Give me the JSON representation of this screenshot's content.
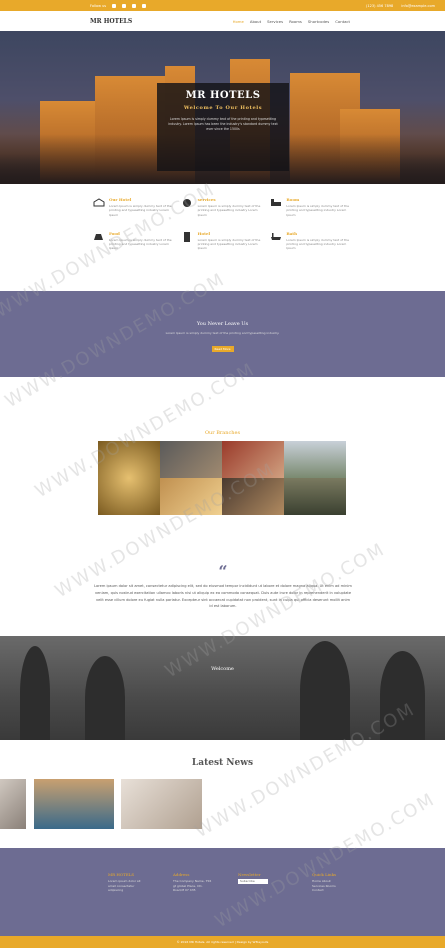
{
  "topbar": {
    "follow_label": "Follow us",
    "social_icons": [
      "facebook-icon",
      "twitter-icon",
      "linkedin-icon",
      "pinterest-icon"
    ],
    "phone": "(123) 456 7898",
    "email": "info@example.com"
  },
  "navbar": {
    "logo": "MR HOTELS",
    "menu": [
      "Home",
      "About",
      "Services",
      "Rooms",
      "Shortcodes",
      "Contact"
    ]
  },
  "hero": {
    "title": "MR HOTELS",
    "subtitle": "Welcome To Our Hotels",
    "text": "Lorem Ipsum is simply dummy text of the printing and typesetting industry. Lorem Ipsum has been the industry's standard dummy text ever since the 1500s"
  },
  "features": [
    {
      "icon": "hotel-icon",
      "title": "Our Hotel",
      "text": "Lorem Ipsum is simply dummy text of the printing and typesetting industry Lorem Ipsum"
    },
    {
      "icon": "services-icon",
      "title": "services",
      "text": "Lorem Ipsum is simply dummy text of the printing and typesetting industry Lorem Ipsum"
    },
    {
      "icon": "room-icon",
      "title": "Room",
      "text": "Lorem Ipsum is simply dummy text of the printing and typesetting industry Lorem Ipsum"
    },
    {
      "icon": "food-icon",
      "title": "Food",
      "text": "Lorem Ipsum is simply dummy text of the printing and typesetting industry Lorem Ipsum"
    },
    {
      "icon": "hotel-building-icon",
      "title": "Hotel",
      "text": "Lorem Ipsum is simply dummy text of the printing and typesetting industry Lorem Ipsum"
    },
    {
      "icon": "bath-icon",
      "title": "Bath",
      "text": "Lorem Ipsum is simply dummy text of the printing and typesetting industry Lorem Ipsum"
    }
  ],
  "band": {
    "title": "You Never Leave Us",
    "text": "Lorem Ipsum is simply dummy text of the printing and typesetting industry.",
    "button": "Read More"
  },
  "branches": {
    "title": "Our Branches"
  },
  "quote": {
    "mark": "“",
    "text": "Lorem ipsum dolor sit amet, consectetur adipiscing elit, sed do eiusmod tempor incididunt ut labore et dolore magna aliqua. Ut enim ad minim veniam, quis nostrud exercitation ullamco laboris nisi ut aliquip ex ea commodo consequat. Duis aute irure dolor in reprehenderit in voluptate velit esse cillum dolore eu fugiat nulla pariatur. Excepteur sint occaecat cupidatat non proident, sunt in culpa qui officia deserunt mollit anim id est laborum."
  },
  "welcome": {
    "title": "Welcome"
  },
  "news": {
    "title": "Latest News"
  },
  "footer": {
    "col1": {
      "title": "MR HOTELS",
      "text": "Lorem ipsum dolor sit amet consectetur adipiscing"
    },
    "col2": {
      "title": "Address",
      "text": "The Company Name, 756 gt globel Place, CD-Road,M 07 435"
    },
    "col3": {
      "title": "Newsletter",
      "text": "Subscribe"
    },
    "col4": {
      "title": "Quick Links",
      "text": "Home About Services Rooms Contact"
    }
  },
  "copyright": "© 2016 MR Hotels. All rights reserved | Design by W3layouts",
  "watermark": "WWW.DOWNDEMO.COM",
  "colors": {
    "accent": "#e8a92a",
    "band": "#6d6c92"
  }
}
